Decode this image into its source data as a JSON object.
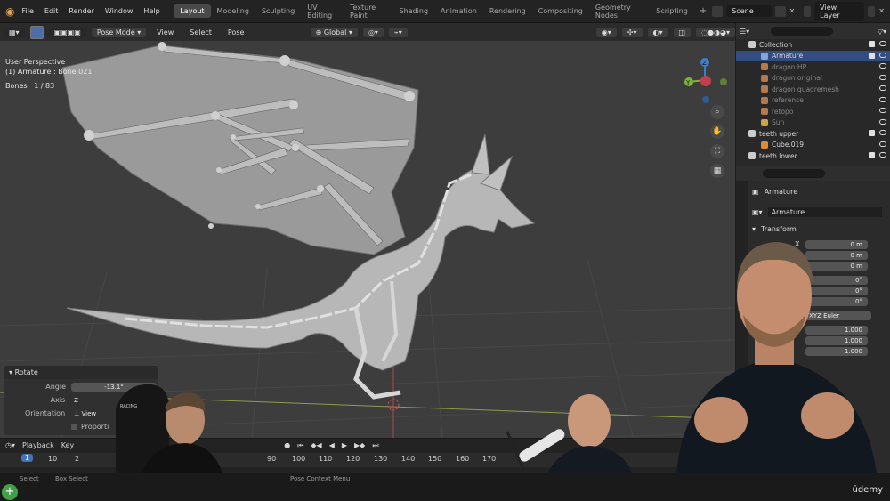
{
  "topbar": {
    "menus": [
      "File",
      "Edit",
      "Render",
      "Window",
      "Help"
    ],
    "workspaces": [
      "Layout",
      "Modeling",
      "Sculpting",
      "UV Editing",
      "Texture Paint",
      "Shading",
      "Animation",
      "Rendering",
      "Compositing",
      "Geometry Nodes",
      "Scripting"
    ],
    "active_workspace": "Layout",
    "scene": "Scene",
    "view_layer": "View Layer"
  },
  "viewport_header": {
    "mode": "Pose Mode",
    "menus": [
      "View",
      "Select",
      "Pose"
    ],
    "orientation": "Global",
    "pose_options": "Pose Options"
  },
  "viewport": {
    "view_label": "User Perspective",
    "object_label": "(1) Armature : Bone.021",
    "bones_label": "Bones",
    "bones_value": "1 / 83",
    "gizmo": {
      "z_label": "Z",
      "y_label": "Y"
    }
  },
  "rotate_panel": {
    "title": "Rotate",
    "angle_label": "Angle",
    "angle_value": "-13.1°",
    "axis_label": "Axis",
    "axis_value": "Z",
    "orientation_label": "Orientation",
    "orientation_value": "View",
    "proportional_label": "Proporti"
  },
  "timeline": {
    "playback": "Playback",
    "keying": "Key",
    "current_frame": "1",
    "ticks": [
      "10",
      "2",
      "90",
      "100",
      "110",
      "120",
      "130",
      "140",
      "150",
      "160",
      "170"
    ]
  },
  "statusbar": {
    "select": "Select",
    "box_select": "Box Select",
    "context": "Pose Context Menu"
  },
  "outliner": {
    "items": [
      {
        "label": "Collection",
        "dim": false,
        "selected": false
      },
      {
        "label": "Armature",
        "dim": false,
        "selected": true
      },
      {
        "label": "dragon HP",
        "dim": true,
        "selected": false
      },
      {
        "label": "dragon original",
        "dim": true,
        "selected": false
      },
      {
        "label": "dragon quadremesh",
        "dim": true,
        "selected": false
      },
      {
        "label": "reference",
        "dim": true,
        "selected": false
      },
      {
        "label": "retopo",
        "dim": true,
        "selected": false
      },
      {
        "label": "Sun",
        "dim": true,
        "selected": false
      },
      {
        "label": "teeth upper",
        "dim": false,
        "selected": false
      },
      {
        "label": "Cube.019",
        "dim": false,
        "selected": false
      },
      {
        "label": "teeth lower",
        "dim": false,
        "selected": false
      }
    ]
  },
  "properties": {
    "object_name": "Armature",
    "data_name": "Armature",
    "section": "Transform",
    "loc_x_label": "X",
    "location": [
      "0 m",
      "0 m",
      "0 m"
    ],
    "rotation": [
      "0°",
      "0°",
      "0°"
    ],
    "rotation_mode": "XYZ Euler",
    "scale": [
      "1.000",
      "1.000",
      "1.000"
    ]
  },
  "overlay": {
    "brand": "ūdemy",
    "chair_text": "RACING"
  },
  "colors": {
    "accent": "#4772b3",
    "outliner_selected": "#334d80",
    "gizmo_x": "#c2404c",
    "gizmo_y": "#7fb33a",
    "gizmo_z": "#3d7fcf"
  }
}
